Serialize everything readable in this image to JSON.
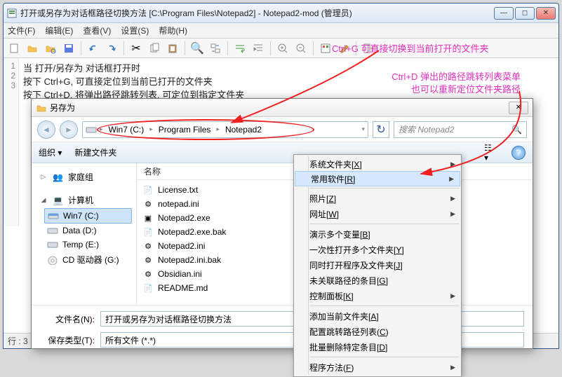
{
  "window": {
    "title": "打开或另存为对话框路径切换方法 [C:\\Program Files\\Notepad2] - Notepad2-mod (管理员)"
  },
  "menus": [
    "文件(F)",
    "编辑(E)",
    "查看(V)",
    "设置(S)",
    "帮助(H)"
  ],
  "annotations": {
    "a1": "Ctrl+G 可直接切换到当前打开的文件夹",
    "a2_l1": "Ctrl+D 弹出的路径跳转列表菜单",
    "a2_l2": "也可以重新定位文件夹路径"
  },
  "code": {
    "lines": [
      "1",
      "2",
      "3"
    ],
    "l1": "当 打开/另存为 对话框打开时",
    "l2": "按下 Ctrl+G, 可直接定位到当前已打开的文件夹",
    "l3": "按下 Ctrl+D, 将弹出路径跳转列表, 可定位到指定文件夹"
  },
  "status": "行 : 3",
  "dialog": {
    "title": "另存为",
    "crumbs": [
      "Win7 (C:)",
      "Program Files",
      "Notepad2"
    ],
    "search_placeholder": "搜索 Notepad2",
    "toolbar": {
      "organize": "组织 ▾",
      "newfolder": "新建文件夹"
    },
    "sidebar": {
      "homegroup": "家庭组",
      "computer": "计算机",
      "drives": [
        "Win7 (C:)",
        "Data (D:)",
        "Temp (E:)",
        "CD 驱动器 (G:)"
      ]
    },
    "col_name": "名称",
    "files": [
      "License.txt",
      "notepad.ini",
      "Notepad2.exe",
      "Notepad2.exe.bak",
      "Notepad2.ini",
      "Notepad2.ini.bak",
      "Obsidian.ini",
      "README.md"
    ],
    "filename_label": "文件名(N):",
    "filename_value": "打开或另存为对话框路径切换方法",
    "filetype_label": "保存类型(T):",
    "filetype_value": "所有文件 (*.*)"
  },
  "ctx": {
    "items": [
      {
        "t": "系统文件夹[X]",
        "arrow": true
      },
      {
        "t": "常用软件[R]",
        "arrow": true,
        "sel": true
      },
      {
        "sep": true
      },
      {
        "t": "照片[Z]",
        "arrow": true
      },
      {
        "t": "网址[W]",
        "arrow": true
      },
      {
        "sep": true
      },
      {
        "t": "演示多个变量[B]"
      },
      {
        "t": "一次性打开多个文件夹[Y]"
      },
      {
        "t": "同时打开程序及文件夹[J]"
      },
      {
        "t": "未关联路径的条目[G]"
      },
      {
        "t": "控制面板[K]",
        "arrow": true
      },
      {
        "sep": true
      },
      {
        "t": "添加当前文件夹[A]"
      },
      {
        "t": "配置跳转路径列表(C)"
      },
      {
        "t": "批量删除特定条目[D]"
      },
      {
        "sep": true
      },
      {
        "t": "程序方法(F)",
        "arrow": true
      }
    ]
  }
}
